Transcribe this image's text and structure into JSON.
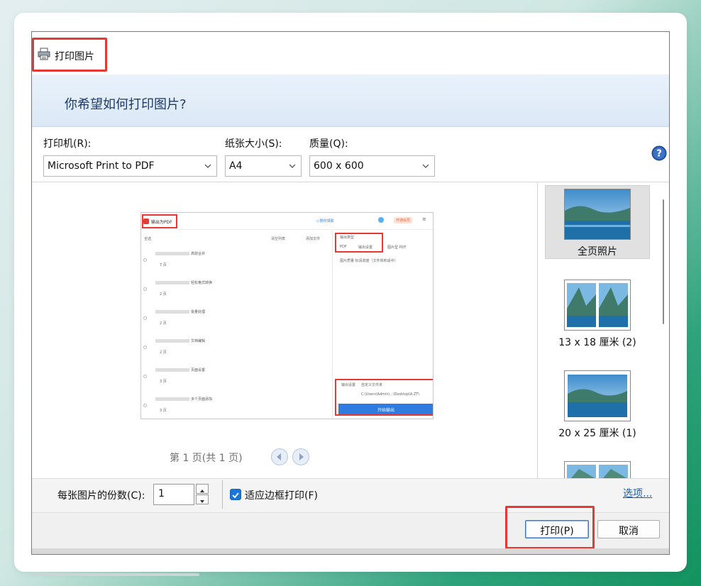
{
  "dialog": {
    "title": "打印图片",
    "heading": "你希望如何打印图片?"
  },
  "options": {
    "printer_label": "打印机(R):",
    "printer_value": "Microsoft Print to PDF",
    "paper_label": "纸张大小(S):",
    "paper_value": "A4",
    "quality_label": "质量(Q):",
    "quality_value": "600 x 600"
  },
  "preview": {
    "page_info": "第 1 页(共 1 页)",
    "mini": {
      "title": "输出为PDF",
      "top_links": [
        "◁ 限时领取",
        "开通会员"
      ],
      "toolbar": [
        "全选",
        "清空列表",
        "添加文件"
      ],
      "settings_type_label": "输出类型",
      "settings_pdf": "PDF",
      "settings_image_pdf": "图片型 PDF",
      "settings_output_setting": "输出设置",
      "settings_quality": "图片质量  标清高度（文件体积适中）",
      "settings_dir_label": "输出设置",
      "settings_dir_value": "自定义文件夹",
      "settings_path": "C:\\Users\\Admin\\...\\Desktop\\A.ZT\\",
      "start_button": "开始输出",
      "rows": [
        {
          "text": "高效合并",
          "pages": "7 页"
        },
        {
          "text": "轻松格式转换",
          "pages": "2 页"
        },
        {
          "text": "批量处理",
          "pages": "2 页"
        },
        {
          "text": "文档编辑",
          "pages": "2 页"
        },
        {
          "text": "页面设置",
          "pages": "3 页"
        },
        {
          "text": "多个页面添加",
          "pages": "3 页"
        }
      ]
    }
  },
  "thumbnails": [
    {
      "label": "全页照片",
      "selected": true
    },
    {
      "label": "13 x 18 厘米 (2)",
      "selected": false
    },
    {
      "label": "20 x 25 厘米 (1)",
      "selected": false
    }
  ],
  "bottom": {
    "copies_label": "每张图片的份数(C):",
    "copies_value": "1",
    "fit_label": "适应边框打印(F)",
    "options_link": "选项..."
  },
  "buttons": {
    "print": "打印(P)",
    "cancel": "取消"
  },
  "colors": {
    "highlight": "#e53935",
    "link": "#1a5fb4",
    "checkbox": "#1976d2",
    "header_text": "#1e3a66"
  }
}
